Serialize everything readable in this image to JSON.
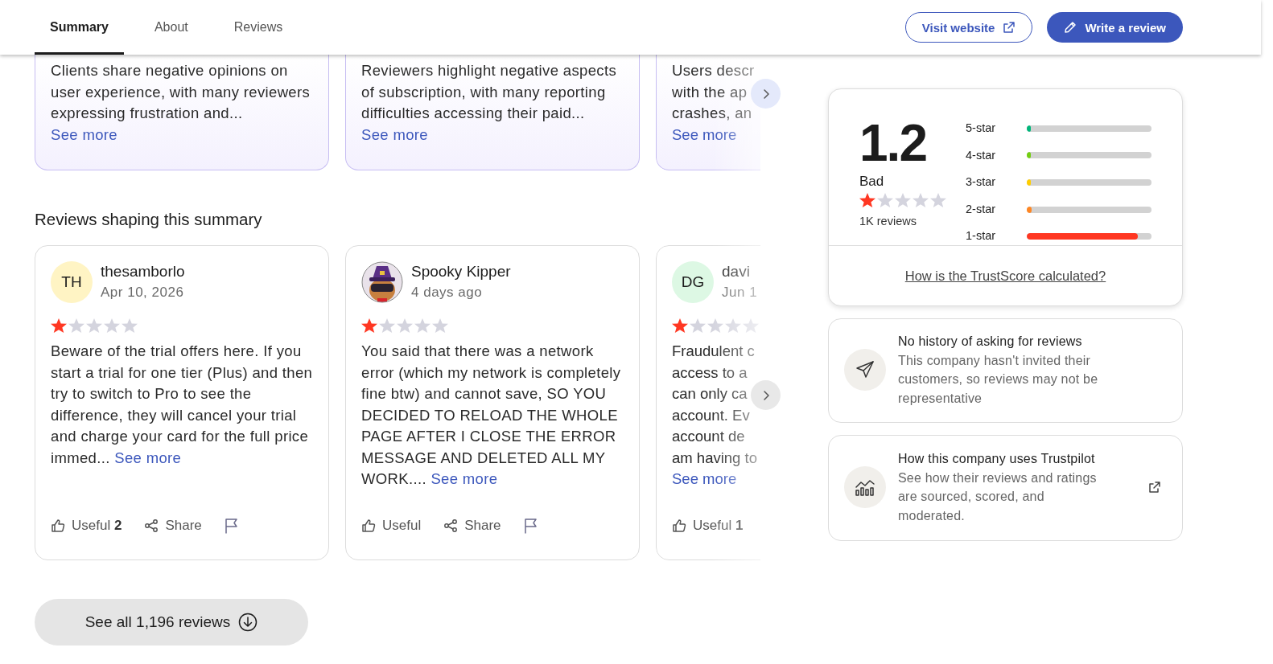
{
  "nav": {
    "tabs": [
      {
        "label": "Summary",
        "selected": true
      },
      {
        "label": "About",
        "selected": false
      },
      {
        "label": "Reviews",
        "selected": false
      }
    ],
    "visit_button": "Visit website",
    "write_button": "Write a review"
  },
  "summaries": [
    {
      "text": "Clients share negative opinions on user experience, with many reviewers expressing frustration and...",
      "link": "See more"
    },
    {
      "text": "Reviewers highlight negative aspects of subscription, with many reporting difficulties accessing their paid...",
      "link": "See more"
    },
    {
      "lines": [
        "Users descr",
        "with the ap",
        "crashes, an"
      ],
      "link": "See more"
    }
  ],
  "reviews_heading": "Reviews shaping this summary",
  "reviews": [
    {
      "avatar": {
        "kind": "initials",
        "text": "TH",
        "color": "#fff4c4"
      },
      "name": "thesamborlo",
      "date": "Apr 10, 2026",
      "stars": 1,
      "text": "Beware of the trial offers here. If you start a trial for one tier (Plus) and then try to switch to Pro to see the difference, they will cancel your trial and charge your card for the full price immed...",
      "link": "See more",
      "useful": "Useful",
      "useful_count": "2",
      "share": "Share"
    },
    {
      "name": "Spooky Kipper",
      "date": "4 days ago",
      "stars": 1,
      "text": "You said that there was a network error (which my network is completely fine btw) and cannot save, SO YOU DECIDED TO RELOAD THE WHOLE PAGE AFTER I CLOSE THE ERROR MESSAGE AND DELETED ALL MY WORK....",
      "link": "See more",
      "useful": "Useful",
      "share": "Share"
    },
    {
      "avatar": {
        "kind": "initials",
        "text": "DG",
        "color": "#ddf8e4"
      },
      "name": "davi",
      "date": "Jun 1",
      "stars": 1,
      "lines": [
        "Fraudulent c",
        "access to a",
        "can only ca",
        "account. Ev",
        "account de",
        "am having to"
      ],
      "link": "See more",
      "useful": "Useful",
      "useful_count": "1"
    }
  ],
  "see_all": "See all 1,196 reviews",
  "rating": {
    "score": "1.2",
    "label": "Bad",
    "stars": 1,
    "count": "1K reviews",
    "distribution": [
      {
        "label": "5-star",
        "level": 0.02,
        "color": "#00b67a"
      },
      {
        "label": "4-star",
        "level": 0.01,
        "color": "#73cf11"
      },
      {
        "label": "3-star",
        "level": 0.01,
        "color": "#ffce00"
      },
      {
        "label": "2-star",
        "level": 0.04,
        "color": "#ff8622"
      },
      {
        "label": "1-star",
        "level": 0.89,
        "color": "#ff3722"
      }
    ],
    "link": "How is the TrustScore calculated?"
  },
  "info_cards": [
    {
      "kind": "invites",
      "title": "No history of asking for reviews",
      "text": "This company hasn't invited their customers, so reviews may not be representative"
    },
    {
      "kind": "usage",
      "title": "How this company uses Trustpilot",
      "text": "See how their reviews and ratings are sourced, scored, and moderated.",
      "external": true
    }
  ]
}
